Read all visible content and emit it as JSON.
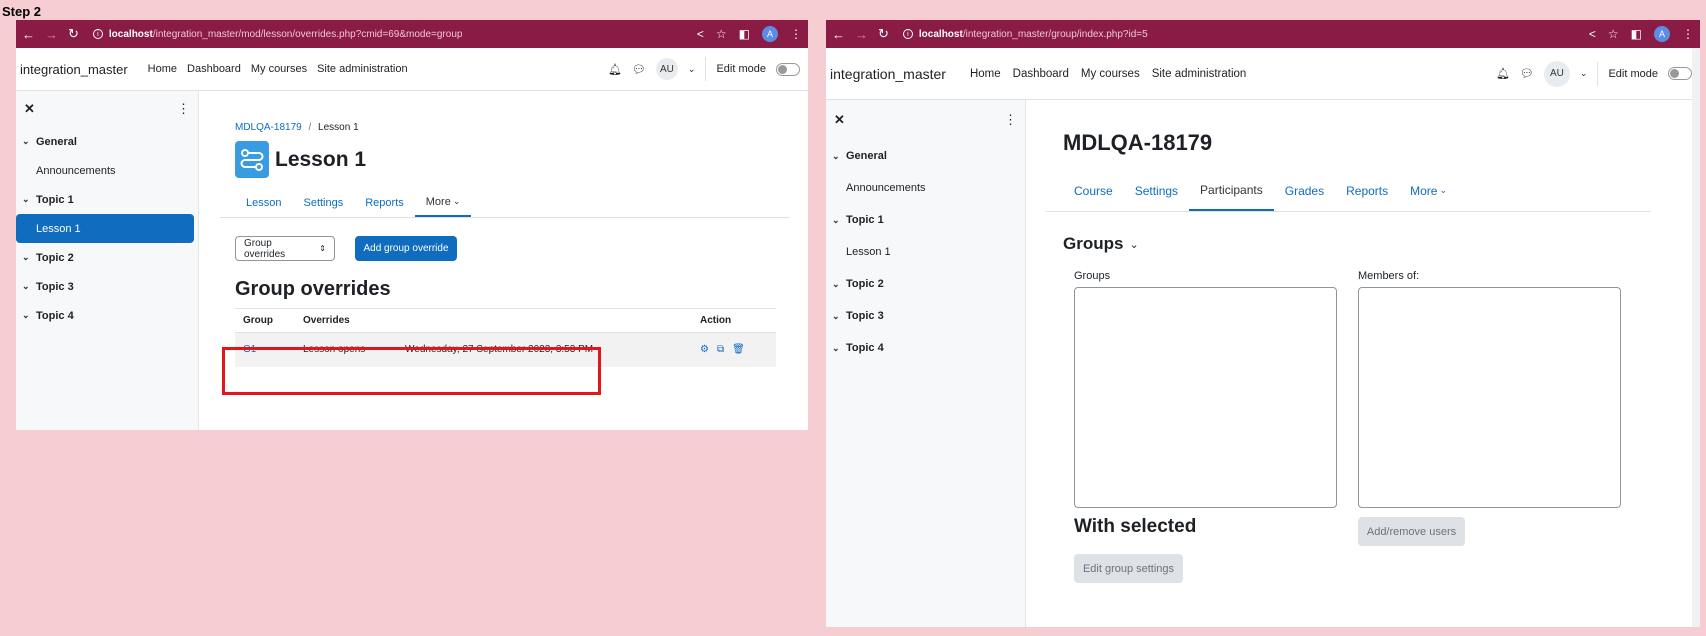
{
  "step_label": "Step 2",
  "left": {
    "url_host": "localhost",
    "url_path": "/integration_master/mod/lesson/overrides.php?cmid=69&mode=group",
    "site_name": "integration_master",
    "nav_links": [
      "Home",
      "Dashboard",
      "My courses",
      "Site administration"
    ],
    "user_initials": "AU",
    "edit_mode_label": "Edit mode",
    "course_index": [
      {
        "label": "General",
        "type": "section"
      },
      {
        "label": "Announcements",
        "type": "item"
      },
      {
        "label": "Topic 1",
        "type": "section"
      },
      {
        "label": "Lesson 1",
        "type": "item",
        "active": true
      },
      {
        "label": "Topic 2",
        "type": "section"
      },
      {
        "label": "Topic 3",
        "type": "section"
      },
      {
        "label": "Topic 4",
        "type": "section"
      }
    ],
    "breadcrumb": {
      "course": "MDLQA-18179",
      "separator": "/",
      "current": "Lesson 1"
    },
    "page_title": "Lesson 1",
    "tabs": [
      "Lesson",
      "Settings",
      "Reports",
      "More"
    ],
    "active_tab": "More",
    "select_label": "Group overrides",
    "add_button": "Add group override",
    "section_title": "Group overrides",
    "table": {
      "headers": [
        "Group",
        "Overrides",
        "",
        "Action"
      ],
      "rows": [
        {
          "group": "G1",
          "override": "Lesson opens",
          "value": "Wednesday, 27 September 2023, 3:53 PM"
        }
      ]
    },
    "accent_color": "#0f6cbf",
    "highlight_color": "#e3151a"
  },
  "right": {
    "url_host": "localhost",
    "url_path": "/integration_master/group/index.php?id=5",
    "site_name": "integration_master",
    "nav_links": [
      "Home",
      "Dashboard",
      "My courses",
      "Site administration"
    ],
    "user_initials": "AU",
    "edit_mode_label": "Edit mode",
    "course_index": [
      {
        "label": "General",
        "type": "section"
      },
      {
        "label": "Announcements",
        "type": "item"
      },
      {
        "label": "Topic 1",
        "type": "section"
      },
      {
        "label": "Lesson 1",
        "type": "item"
      },
      {
        "label": "Topic 2",
        "type": "section"
      },
      {
        "label": "Topic 3",
        "type": "section"
      },
      {
        "label": "Topic 4",
        "type": "section"
      }
    ],
    "page_title": "MDLQA-18179",
    "tabs": [
      "Course",
      "Settings",
      "Participants",
      "Grades",
      "Reports",
      "More"
    ],
    "active_tab": "Participants",
    "groups_heading": "Groups",
    "groups_label": "Groups",
    "members_label": "Members of:",
    "with_selected": "With selected",
    "add_remove_button": "Add/remove users",
    "edit_group_button": "Edit group settings"
  },
  "browser_color": "#8a1b45"
}
